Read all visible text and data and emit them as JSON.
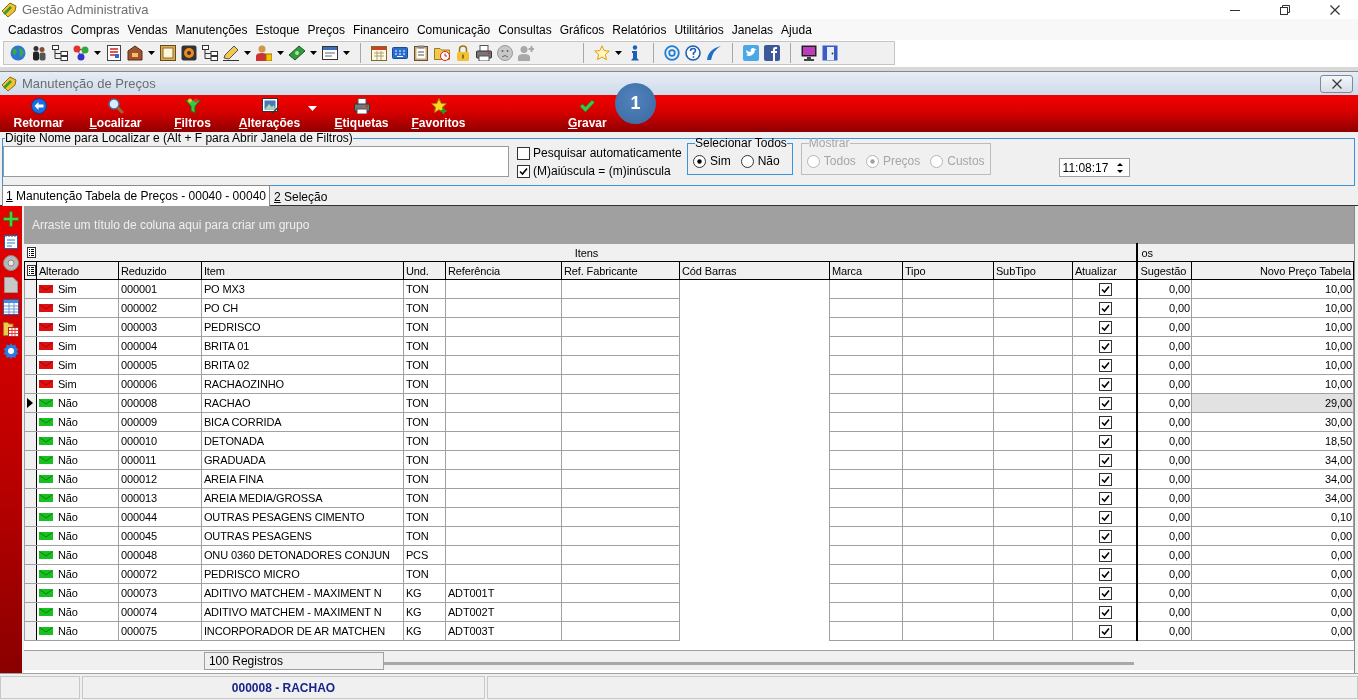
{
  "window": {
    "title": "Gestão Administrativa"
  },
  "menu": [
    "Cadastros",
    "Compras",
    "Vendas",
    "Manutenções",
    "Estoque",
    "Preços",
    "Financeiro",
    "Comunicação",
    "Consultas",
    "Gráficos",
    "Relatórios",
    "Utilitários",
    "Janelas",
    "Ajuda"
  ],
  "child_window": {
    "title": "Manutenção de Preços"
  },
  "actions": [
    {
      "label": "Retornar",
      "underline_first": false,
      "dropdown": false
    },
    {
      "label": "Localizar",
      "underline_first": true,
      "dropdown": false
    },
    {
      "label": "Filtros",
      "underline_first": true,
      "dropdown": false
    },
    {
      "label": "Alterações",
      "underline_first": true,
      "dropdown": true
    },
    {
      "label": "Etiquetas",
      "underline_first": true,
      "dropdown": false
    },
    {
      "label": "Favoritos",
      "underline_first": true,
      "dropdown": false
    }
  ],
  "commit_actions": [
    {
      "label": "Gravar",
      "underline_first": true,
      "dropdown": false
    }
  ],
  "callout": "1",
  "search": {
    "legend": "Digite Nome para Localizar e (Alt + F para Abrir Janela de Filtros)"
  },
  "options": [
    {
      "label": "Pesquisar automaticamente",
      "checked": false
    },
    {
      "label": "(M)aiúscula = (m)inúscula",
      "checked": true
    }
  ],
  "select_all": {
    "title": "Selecionar Todos",
    "options": [
      {
        "label": "Sim",
        "selected": true
      },
      {
        "label": "Não",
        "selected": false
      }
    ]
  },
  "show": {
    "title": "Mostrar",
    "disabled": true,
    "options": [
      {
        "label": "Todos",
        "selected": false
      },
      {
        "label": "Preços",
        "selected": true
      },
      {
        "label": "Custos",
        "selected": false
      }
    ]
  },
  "time": "11:08:17",
  "tabs": [
    {
      "label": "1 Manutenção Tabela de Preços - 00040 - 00040",
      "underline_first": true,
      "selected": true
    },
    {
      "label": "2 Seleção",
      "underline_first": true,
      "selected": false
    }
  ],
  "grid": {
    "group_hint": "Arraste um título de coluna aqui para criar um grupo",
    "bands": [
      "Itens",
      "os"
    ],
    "columns": [
      "Alterado",
      "Reduzido",
      "Item",
      "Und.",
      "Referência",
      "Ref. Fabricante",
      "Cód Barras",
      "Marca",
      "Tipo",
      "SubTipo",
      "Atualizar",
      "Sugestão",
      "Novo Preço Tabela"
    ],
    "rows": [
      {
        "selected": false,
        "changed": true,
        "altered": "Sim",
        "code": "000001",
        "item": "PO MX3",
        "unit": "TON",
        "update": true,
        "suggestion": "0,00",
        "new_price": "10,00"
      },
      {
        "selected": false,
        "changed": true,
        "altered": "Sim",
        "code": "000002",
        "item": "PO CH",
        "unit": "TON",
        "update": true,
        "suggestion": "0,00",
        "new_price": "10,00"
      },
      {
        "selected": false,
        "changed": true,
        "altered": "Sim",
        "code": "000003",
        "item": "PEDRISCO",
        "unit": "TON",
        "update": true,
        "suggestion": "0,00",
        "new_price": "10,00"
      },
      {
        "selected": false,
        "changed": true,
        "altered": "Sim",
        "code": "000004",
        "item": "BRITA 01",
        "unit": "TON",
        "update": true,
        "suggestion": "0,00",
        "new_price": "10,00"
      },
      {
        "selected": false,
        "changed": true,
        "altered": "Sim",
        "code": "000005",
        "item": "BRITA 02",
        "unit": "TON",
        "update": true,
        "suggestion": "0,00",
        "new_price": "10,00"
      },
      {
        "selected": false,
        "changed": true,
        "altered": "Sim",
        "code": "000006",
        "item": "RACHAOZINHO",
        "unit": "TON",
        "update": true,
        "suggestion": "0,00",
        "new_price": "10,00"
      },
      {
        "selected": true,
        "changed": false,
        "altered": "Não",
        "code": "000008",
        "item": "RACHAO",
        "unit": "TON",
        "update": true,
        "suggestion": "0,00",
        "new_price": "29,00"
      },
      {
        "selected": false,
        "changed": false,
        "altered": "Não",
        "code": "000009",
        "item": "BICA CORRIDA",
        "unit": "TON",
        "update": true,
        "suggestion": "0,00",
        "new_price": "30,00"
      },
      {
        "selected": false,
        "changed": false,
        "altered": "Não",
        "code": "000010",
        "item": "DETONADA",
        "unit": "TON",
        "update": true,
        "suggestion": "0,00",
        "new_price": "18,50"
      },
      {
        "selected": false,
        "changed": false,
        "altered": "Não",
        "code": "000011",
        "item": "GRADUADA",
        "unit": "TON",
        "update": true,
        "suggestion": "0,00",
        "new_price": "34,00"
      },
      {
        "selected": false,
        "changed": false,
        "altered": "Não",
        "code": "000012",
        "item": "AREIA FINA",
        "unit": "TON",
        "update": true,
        "suggestion": "0,00",
        "new_price": "34,00"
      },
      {
        "selected": false,
        "changed": false,
        "altered": "Não",
        "code": "000013",
        "item": "AREIA MEDIA/GROSSA",
        "unit": "TON",
        "update": true,
        "suggestion": "0,00",
        "new_price": "34,00"
      },
      {
        "selected": false,
        "changed": false,
        "altered": "Não",
        "code": "000044",
        "item": "OUTRAS PESAGENS CIMENTO",
        "unit": "TON",
        "update": true,
        "suggestion": "0,00",
        "new_price": "0,10"
      },
      {
        "selected": false,
        "changed": false,
        "altered": "Não",
        "code": "000045",
        "item": "OUTRAS PESAGENS",
        "unit": "TON",
        "update": true,
        "suggestion": "0,00",
        "new_price": "0,00"
      },
      {
        "selected": false,
        "changed": false,
        "altered": "Não",
        "code": "000048",
        "item": "ONU 0360 DETONADORES CONJUN",
        "unit": "PCS",
        "update": true,
        "suggestion": "0,00",
        "new_price": "0,00"
      },
      {
        "selected": false,
        "changed": false,
        "altered": "Não",
        "code": "000072",
        "item": "PEDRISCO MICRO",
        "unit": "TON",
        "update": true,
        "suggestion": "0,00",
        "new_price": "0,00"
      },
      {
        "selected": false,
        "changed": false,
        "altered": "Não",
        "code": "000073",
        "item": "ADITIVO MATCHEM - MAXIMENT N",
        "unit": "KG",
        "reference": "ADT001T",
        "update": true,
        "suggestion": "0,00",
        "new_price": "0,00"
      },
      {
        "selected": false,
        "changed": false,
        "altered": "Não",
        "code": "000074",
        "item": "ADITIVO MATCHEM - MAXIMENT N",
        "unit": "KG",
        "reference": "ADT002T",
        "update": true,
        "suggestion": "0,00",
        "new_price": "0,00"
      },
      {
        "selected": false,
        "changed": false,
        "altered": "Não",
        "code": "000075",
        "item": "INCORPORADOR DE AR MATCHEN",
        "unit": "KG",
        "reference": "ADT003T",
        "update": true,
        "suggestion": "0,00",
        "new_price": "0,00"
      }
    ],
    "record_count": "100 Registros"
  },
  "status_bar": {
    "current_record": "000008 - RACHAO"
  }
}
